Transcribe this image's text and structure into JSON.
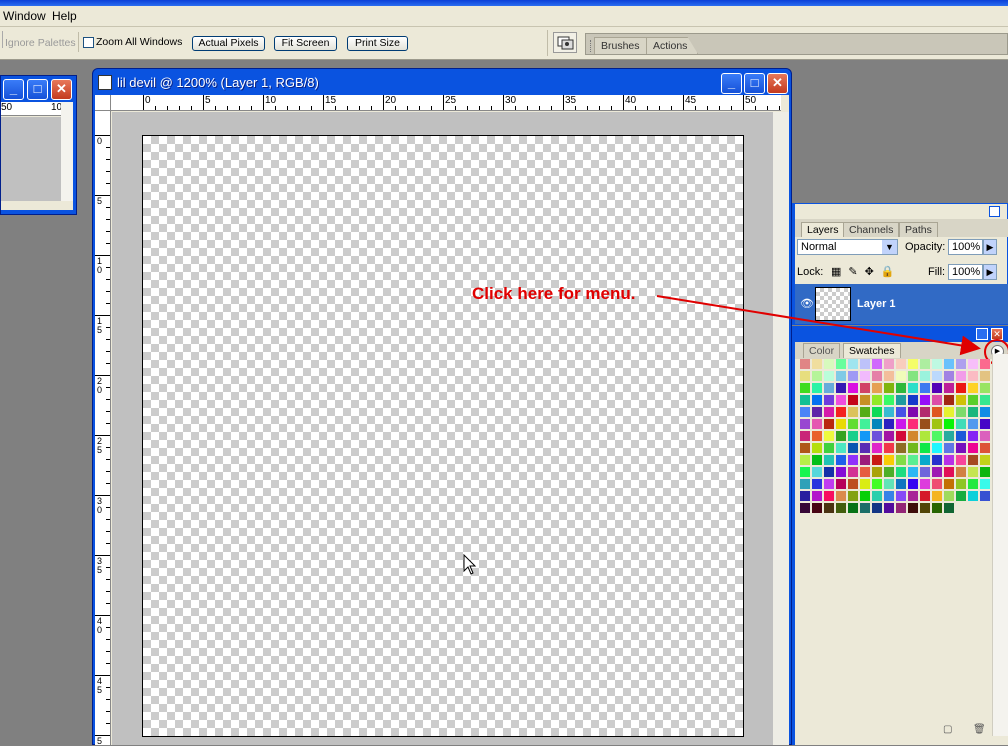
{
  "menubar": {
    "items": [
      "Window",
      "Help"
    ]
  },
  "options_bar": {
    "ignore_palettes": "Ignore Palettes",
    "zoom_all_windows": "Zoom All Windows",
    "actual_pixels": "Actual Pixels",
    "fit_screen": "Fit Screen",
    "print_size": "Print Size"
  },
  "palette_well": {
    "tabs": [
      "Brushes",
      "Actions"
    ]
  },
  "small_window": {
    "ruler_labels": [
      "50",
      "10"
    ]
  },
  "document": {
    "title": "lil devil @ 1200% (Layer 1, RGB/8)",
    "hruler": [
      "0",
      "5",
      "10",
      "15",
      "20",
      "25",
      "30",
      "35",
      "40",
      "45",
      "50"
    ],
    "vruler": [
      "0",
      "5",
      "10",
      "15",
      "20",
      "25",
      "30",
      "35",
      "40",
      "45",
      "5"
    ]
  },
  "layers_panel": {
    "tabs": [
      "Layers",
      "Channels",
      "Paths"
    ],
    "blend_mode": "Normal",
    "opacity_label": "Opacity:",
    "opacity_value": "100%",
    "lock_label": "Lock:",
    "fill_label": "Fill:",
    "fill_value": "100%",
    "layer_name": "Layer 1"
  },
  "swatches_panel": {
    "tabs": [
      "Color",
      "Swatches"
    ]
  },
  "annotation": {
    "text": "Click here for menu.",
    "color": "#e00000"
  },
  "colors": {
    "xp_blue": "#0a53e0",
    "selection": "#316ac5",
    "panel": "#ece9d8"
  }
}
